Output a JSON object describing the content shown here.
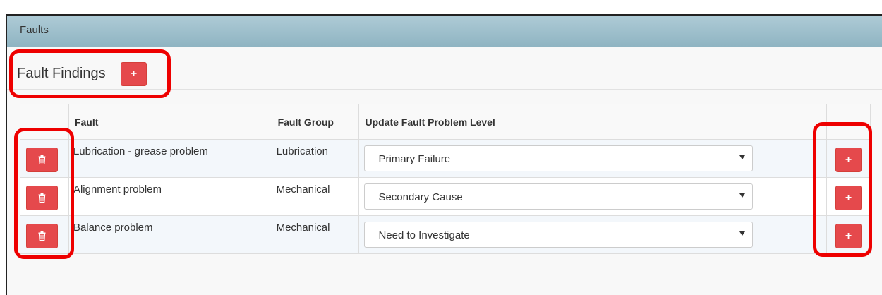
{
  "panel": {
    "title": "Faults"
  },
  "section": {
    "title": "Fault Findings",
    "add_label": "+"
  },
  "table": {
    "headers": {
      "actions": "",
      "fault": "Fault",
      "fault_group": "Fault Group",
      "problem_level": "Update Fault Problem Level",
      "add": ""
    },
    "rows": [
      {
        "fault": "Lubrication - grease problem",
        "group": "Lubrication",
        "level": "Primary Failure",
        "add_label": "+"
      },
      {
        "fault": "Alignment problem",
        "group": "Mechanical",
        "level": "Secondary Cause",
        "add_label": "+"
      },
      {
        "fault": "Balance problem",
        "group": "Mechanical",
        "level": "Need to Investigate",
        "add_label": "+"
      }
    ]
  },
  "icons": {
    "delete": "trash-icon",
    "add": "plus-icon",
    "dropdown": "chevron-down-icon"
  },
  "colors": {
    "header_bar": "#9fbfcc",
    "danger_button": "#e5494c",
    "callout": "#ee0000"
  }
}
